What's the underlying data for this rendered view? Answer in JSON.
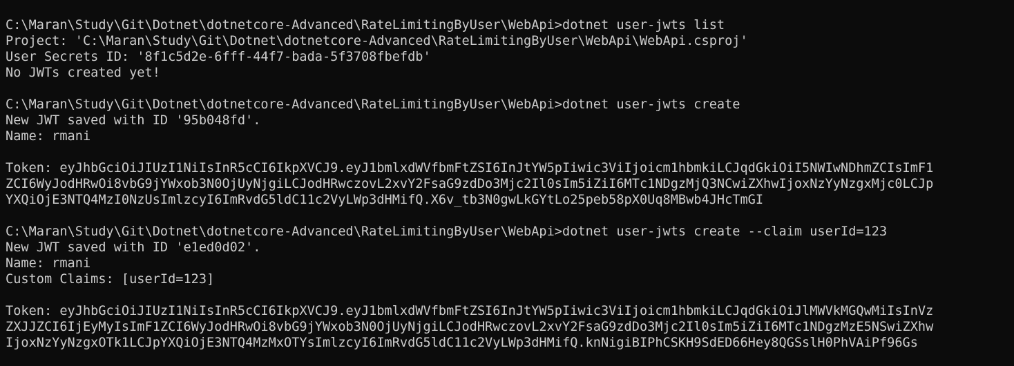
{
  "terminal": {
    "lines": [
      "C:\\Maran\\Study\\Git\\Dotnet\\dotnetcore-Advanced\\RateLimitingByUser\\WebApi>dotnet user-jwts list",
      "Project: 'C:\\Maran\\Study\\Git\\Dotnet\\dotnetcore-Advanced\\RateLimitingByUser\\WebApi\\WebApi.csproj'",
      "User Secrets ID: '8f1c5d2e-6fff-44f7-bada-5f3708fbefdb'",
      "No JWTs created yet!",
      "",
      "C:\\Maran\\Study\\Git\\Dotnet\\dotnetcore-Advanced\\RateLimitingByUser\\WebApi>dotnet user-jwts create",
      "New JWT saved with ID '95b048fd'.",
      "Name: rmani",
      "",
      "Token: eyJhbGciOiJIUzI1NiIsInR5cCI6IkpXVCJ9.eyJ1bmlxdWVfbmFtZSI6InJtYW5pIiwic3ViIjoicm1hbmkiLCJqdGkiOiI5NWIwNDhmZCIsImF1",
      "ZCI6WyJodHRwOi8vbG9jYWxob3N0OjUyNjgiLCJodHRwczovL2xvY2FsaG9zdDo3Mjc2Il0sIm5iZiI6MTc1NDgzMjQ3NCwiZXhwIjoxNzYyNzgxMjc0LCJp",
      "YXQiOjE3NTQ4MzI0NzUsImlzcyI6ImRvdG5ldC11c2VyLWp3dHMifQ.X6v_tb3N0gwLkGYtLo25peb58pX0Uq8MBwb4JHcTmGI",
      "",
      "C:\\Maran\\Study\\Git\\Dotnet\\dotnetcore-Advanced\\RateLimitingByUser\\WebApi>dotnet user-jwts create --claim userId=123",
      "New JWT saved with ID 'e1ed0d02'.",
      "Name: rmani",
      "Custom Claims: [userId=123]",
      "",
      "Token: eyJhbGciOiJIUzI1NiIsInR5cCI6IkpXVCJ9.eyJ1bmlxdWVfbmFtZSI6InJtYW5pIiwic3ViIjoicm1hbmkiLCJqdGkiOiJlMWVkMGQwMiIsInVz",
      "ZXJJZCI6IjEyMyIsImF1ZCI6WyJodHRwOi8vbG9jYWxob3N0OjUyNjgiLCJodHRwczovL2xvY2FsaG9zdDo3Mjc2Il0sIm5iZiI6MTc1NDgzMzE5NSwiZXhw",
      "IjoxNzYyNzgxOTk1LCJpYXQiOjE3NTQ4MzMxOTYsImlzcyI6ImRvdG5ldC11c2VyLWp3dHMifQ.knNigiBIPhCSKH9SdED66Hey8QGSslH0PhVAiPf96Gs"
    ]
  }
}
